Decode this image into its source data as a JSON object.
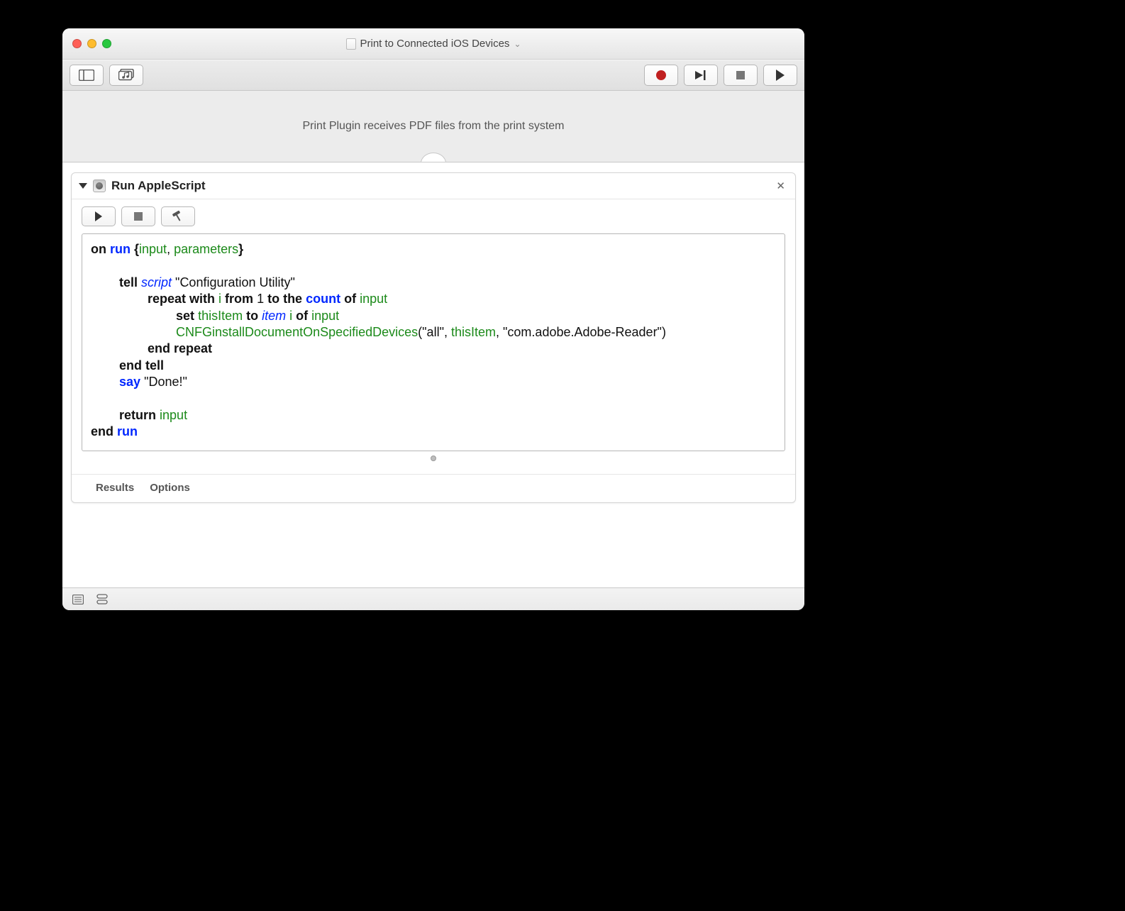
{
  "window": {
    "title": "Print to Connected iOS Devices"
  },
  "description": "Print Plugin receives PDF files from the print system",
  "action": {
    "title": "Run AppleScript",
    "footer": {
      "results": "Results",
      "options": "Options"
    }
  },
  "code": {
    "l1_on": "on ",
    "l1_run": "run",
    "l1_brace_open": " {",
    "l1_input": "input",
    "l1_comma": ", ",
    "l1_params": "parameters",
    "l1_brace_close": "}",
    "l3_tell": "tell ",
    "l3_script": "script",
    "l3_name": " \"Configuration Utility\"",
    "l4_repeat": "repeat with ",
    "l4_i": "i",
    "l4_from": " from ",
    "l4_one": "1",
    "l4_to_the": " to the ",
    "l4_count": "count",
    "l4_of": " of ",
    "l4_input": "input",
    "l5_set": "set ",
    "l5_thisItem": "thisItem",
    "l5_to": " to ",
    "l5_item": "item",
    "l5_sp": " ",
    "l5_i": "i",
    "l5_of": " of ",
    "l5_input": "input",
    "l6_fn": "CNFGinstallDocumentOnSpecifiedDevices",
    "l6_open": "(",
    "l6_all": "\"all\"",
    "l6_c1": ", ",
    "l6_thisItem": "thisItem",
    "l6_c2": ", ",
    "l6_bundle": "\"com.adobe.Adobe-Reader\"",
    "l6_close": ")",
    "l7_endrepeat": "end repeat",
    "l8_endtell": "end tell",
    "l9_say": "say",
    "l9_done": " \"Done!\"",
    "l11_return": "return ",
    "l11_input": "input",
    "l12_end": "end ",
    "l12_run": "run"
  }
}
